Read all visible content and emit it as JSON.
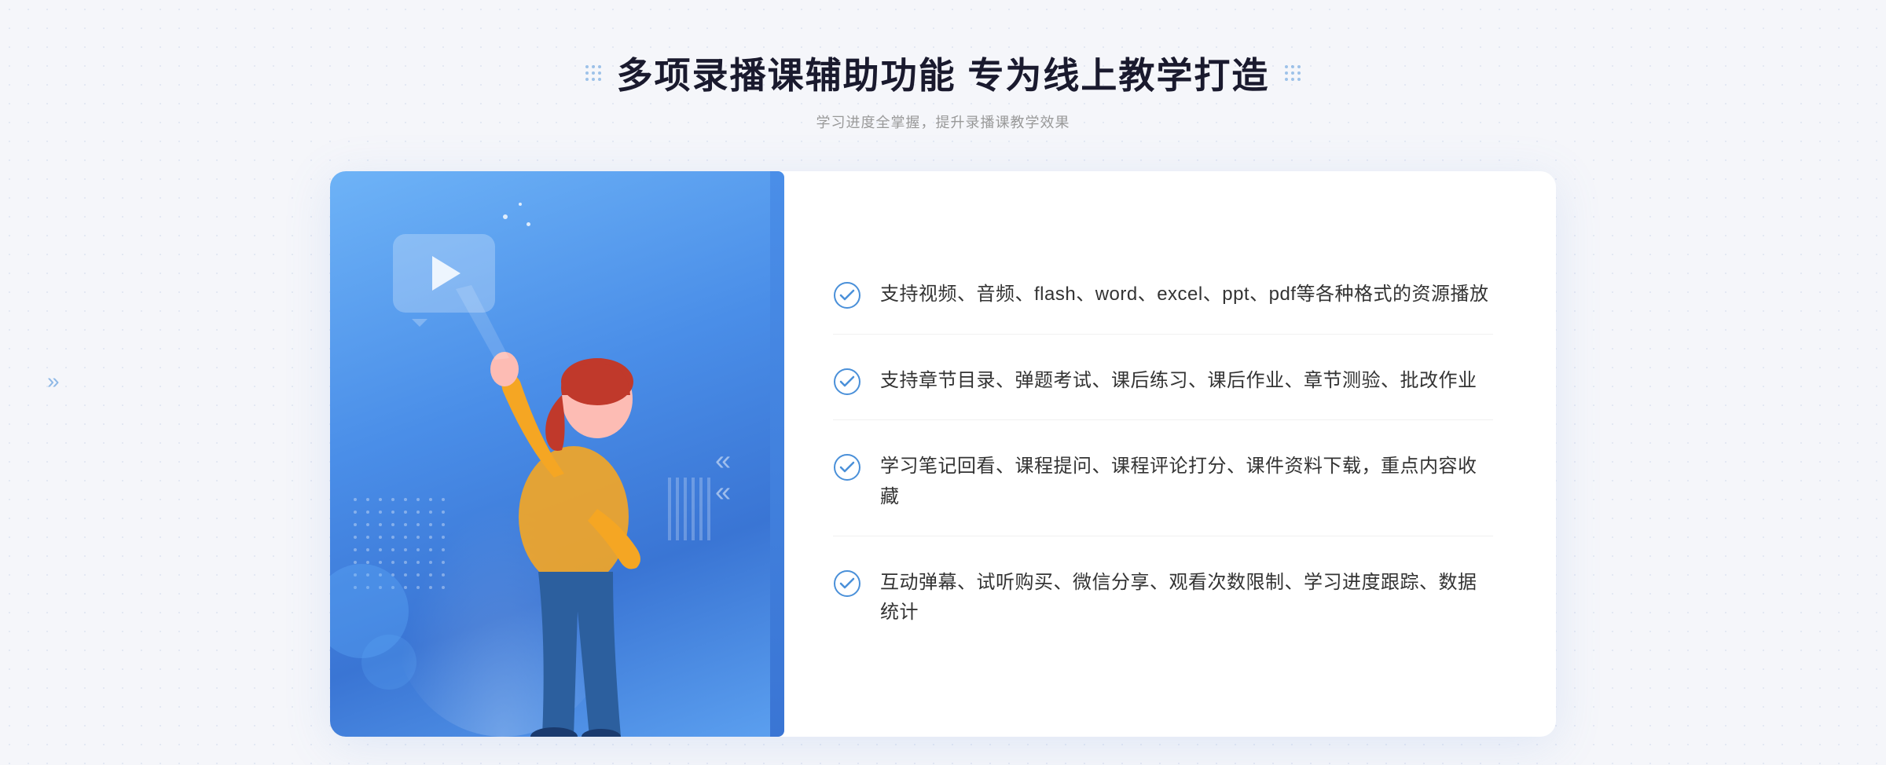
{
  "header": {
    "main_title": "多项录播课辅助功能 专为线上教学打造",
    "sub_title": "学习进度全掌握，提升录播课教学效果",
    "decorative_dots_left": "decorative-dots-left",
    "decorative_dots_right": "decorative-dots-right"
  },
  "features": [
    {
      "id": 1,
      "text": "支持视频、音频、flash、word、excel、ppt、pdf等各种格式的资源播放"
    },
    {
      "id": 2,
      "text": "支持章节目录、弹题考试、课后练习、课后作业、章节测验、批改作业"
    },
    {
      "id": 3,
      "text": "学习笔记回看、课程提问、课程评论打分、课件资料下载，重点内容收藏"
    },
    {
      "id": 4,
      "text": "互动弹幕、试听购买、微信分享、观看次数限制、学习进度跟踪、数据统计"
    }
  ],
  "colors": {
    "primary_blue": "#4a8ee8",
    "light_blue": "#6eb3f7",
    "text_dark": "#1a1a2e",
    "text_gray": "#999999",
    "text_body": "#333333",
    "check_color": "#4a90d9",
    "background": "#f5f6fa"
  },
  "illustration": {
    "play_button_label": "play",
    "arrow_symbol": "»"
  }
}
